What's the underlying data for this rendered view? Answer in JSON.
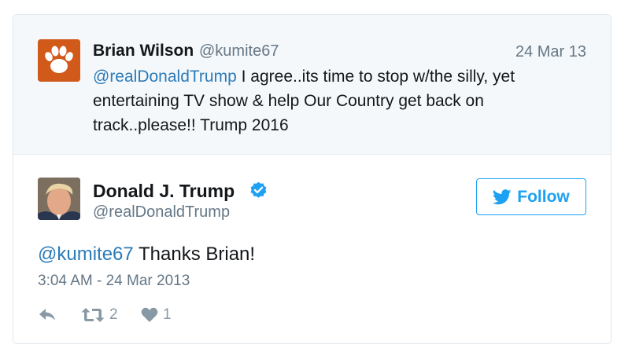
{
  "quoted_tweet": {
    "author_name": "Brian Wilson",
    "author_handle": "@kumite67",
    "date": "24 Mar 13",
    "mention": "@realDonaldTrump",
    "text": " I agree..its time to stop w/the silly, yet entertaining TV show & help Our Country get back on track..please!! Trump 2016",
    "avatar_icon": "tiger-paw-icon",
    "avatar_color": "#d15a1a"
  },
  "tweet": {
    "author_name": "Donald J. Trump",
    "author_handle": "@realDonaldTrump",
    "verified_icon": "verified-badge-icon",
    "follow_label": "Follow",
    "mention": "@kumite67",
    "text": " Thanks Brian!",
    "timestamp": "3:04 AM - 24 Mar 2013",
    "retweet_count": "2",
    "like_count": "1"
  },
  "colors": {
    "link": "#2b7bb9",
    "accent": "#1da1f2",
    "muted": "#657786",
    "quoted_background": "#f5f8fa"
  }
}
